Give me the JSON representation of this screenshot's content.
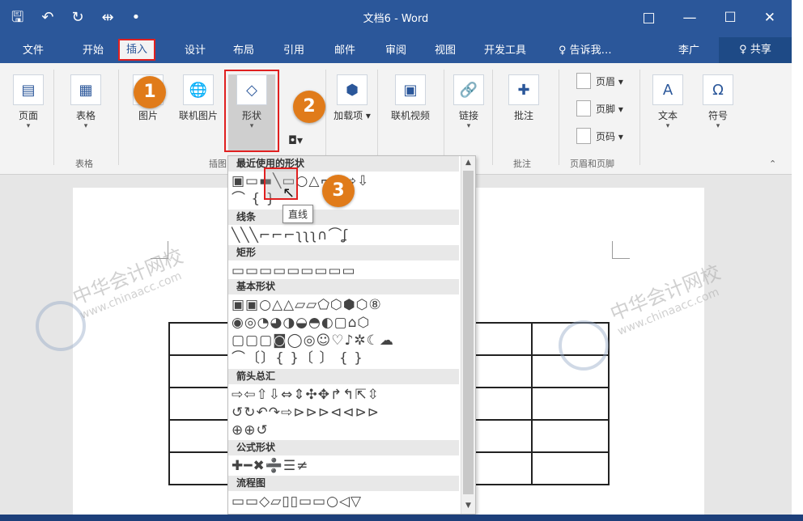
{
  "window": {
    "title": "文档6 - Word",
    "qat_icons": [
      "save-icon",
      "undo-icon",
      "redo-icon",
      "touch-mode-icon",
      "customize-qat-icon"
    ],
    "qat_glyphs": [
      "🖫",
      "↶",
      "↻",
      "⇹",
      "•"
    ],
    "controls": [
      "□",
      "—",
      "☐",
      "✕"
    ]
  },
  "tabs": [
    {
      "label": "文件"
    },
    {
      "label": "开始"
    },
    {
      "label": "插入"
    },
    {
      "label": "设计"
    },
    {
      "label": "布局"
    },
    {
      "label": "引用"
    },
    {
      "label": "邮件"
    },
    {
      "label": "审阅"
    },
    {
      "label": "视图"
    },
    {
      "label": "开发工具"
    }
  ],
  "tell_me": "♀ 告诉我…",
  "user": "李广",
  "share": "♀ 共享",
  "ribbon": {
    "page": {
      "label": "页面",
      "glyph": "▤"
    },
    "table": {
      "label": "表格",
      "glyph": "▦"
    },
    "group_table": "表格",
    "picture": {
      "label": "图片",
      "glyph": "🖼"
    },
    "online_picture": {
      "label": "联机图片",
      "glyph": "🌐"
    },
    "shapes": {
      "label": "形状",
      "glyph": "◇"
    },
    "addins": {
      "label": "加载项 ▾",
      "glyph": "⬢"
    },
    "online_video": {
      "label": "联机视频",
      "glyph": "▣"
    },
    "link": {
      "label": "链接",
      "glyph": "🔗"
    },
    "comment": {
      "label": "批注",
      "glyph": "✚"
    },
    "group_comment": "批注",
    "header": "页眉 ▾",
    "footer": "页脚 ▾",
    "page_number": "页码 ▾",
    "group_header_footer": "页眉和页脚",
    "textbox": {
      "label": "文本",
      "glyph": "A"
    },
    "symbol": {
      "label": "符号",
      "glyph": "Ω"
    },
    "group_illustration_partial": "插图"
  },
  "steps": [
    "1",
    "2",
    "3"
  ],
  "shapes_panel": {
    "recent_header": "最近使用的形状",
    "recent_rows": [
      "▣▭▬╲▭○△⌐⌐⇨⇩",
      "⌒ {  }"
    ],
    "lines_header": "线条",
    "lines_row": "╲╲╲⌐⌐⌐ʅʅʅ∩⌒ʆ",
    "rect_header": "矩形",
    "rect_row": "▭▭▭▭▭▭▭▭▭",
    "basic_header": "基本形状",
    "basic_rows": [
      "▣▣○△△▱▱⬠⬡⬢⬡⑧",
      "◉◎◔◕◑◒◓◐▢⌂⬡",
      "▢▢▢◙◯◎☺♡♪✲☾☁",
      "⌒〔〕{ }〔 〕 {  }"
    ],
    "arrows_header": "箭头总汇",
    "arrows_rows": [
      "⇨⇦⇧⇩⇔⇕✣✥↱↰⇱⇳",
      "↺↻↶↷⇨⊳⊳⊳⊲⊲⊳⊳",
      "⊕⊕↺"
    ],
    "equation_header": "公式形状",
    "equation_row": "✚━✖➗☰≠",
    "flow_header": "流程图",
    "flow_row": "▭▭◇▱▯▯▭▭○◁▽"
  },
  "tooltip": "直线",
  "watermark": {
    "cn": "中华会计网校",
    "en": "www.chinaacc.com"
  }
}
